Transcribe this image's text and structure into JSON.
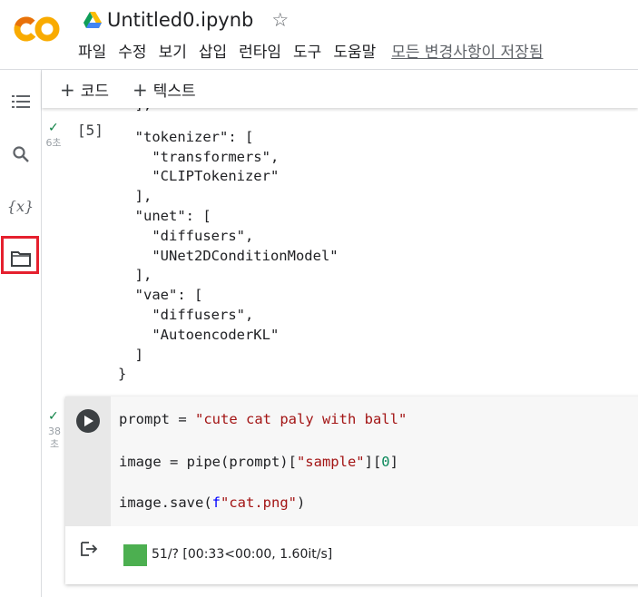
{
  "header": {
    "notebook_title": "Untitled0.ipynb",
    "menu": [
      "파일",
      "수정",
      "보기",
      "삽입",
      "런타임",
      "도구",
      "도움말"
    ],
    "save_status": "모든 변경사항이 저장됨"
  },
  "toolbar": {
    "add_code": "코드",
    "add_text": "텍스트"
  },
  "sidebar": {
    "icons": [
      "toc-icon",
      "search-icon",
      "variables-icon",
      "folder-icon"
    ],
    "variables_label": "{x}"
  },
  "cell1": {
    "exec_time": "6초",
    "exec_count": "[5]",
    "output_lines": [
      "  ],",
      "  \"tokenizer\": [",
      "    \"transformers\",",
      "    \"CLIPTokenizer\"",
      "  ],",
      "  \"unet\": [",
      "    \"diffusers\",",
      "    \"UNet2DConditionModel\"",
      "  ],",
      "  \"vae\": [",
      "    \"diffusers\",",
      "    \"AutoencoderKL\"",
      "  ]",
      "}"
    ]
  },
  "cell2": {
    "exec_time_top": "38",
    "exec_time_bottom": "초",
    "code": {
      "l1_a": "prompt = ",
      "l1_b": "\"cute cat paly with ball\"",
      "l2_a": "image = pipe(prompt)[",
      "l2_b": "\"sample\"",
      "l2_c": "][",
      "l2_d": "0",
      "l2_e": "]",
      "l3_a": "image.save(",
      "l3_b": "f",
      "l3_c": "\"cat.png\"",
      "l3_d": ")"
    },
    "progress_text": "51/? [00:33<00:00, 1.60it/s]",
    "progress_color": "#4caf50"
  }
}
